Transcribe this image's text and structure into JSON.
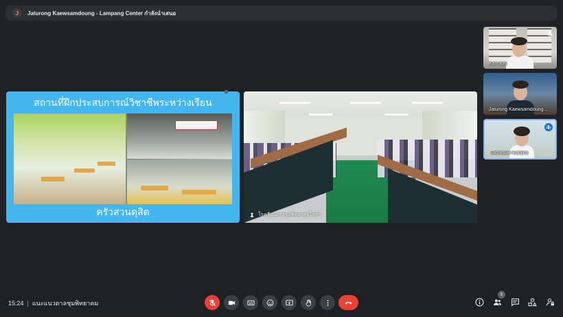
{
  "meeting": {
    "presenter_initial": "J",
    "title": "Jaturong Kaewsamdoung - Lampang Center กำลังนำเสนอ",
    "code": "แนะแนวตาลชุมพิทยาคม",
    "time": "15:24"
  },
  "slide": {
    "title": "สถานที่ฝึกประสบการณ์วิชาชีพระหว่างเรียน",
    "caption": "ครัวสวนดุสิต"
  },
  "main_tile": {
    "label": "โรงเรียนตาลชุมพิทยาคมโสตฯ"
  },
  "participants": [
    {
      "name": "Kan way",
      "mic": "muted"
    },
    {
      "name": "Jaturong Kaewsamdoung...",
      "mic": "none"
    },
    {
      "name": "Saowalak Kanjina",
      "mic": "speaking"
    }
  ],
  "controls": {
    "participants_count": "5"
  },
  "colors": {
    "background": "#202124",
    "end_call": "#ea4335",
    "control": "#3c4043",
    "slide_blue": "#43b6ef",
    "active_border": "#8ab4f8"
  }
}
